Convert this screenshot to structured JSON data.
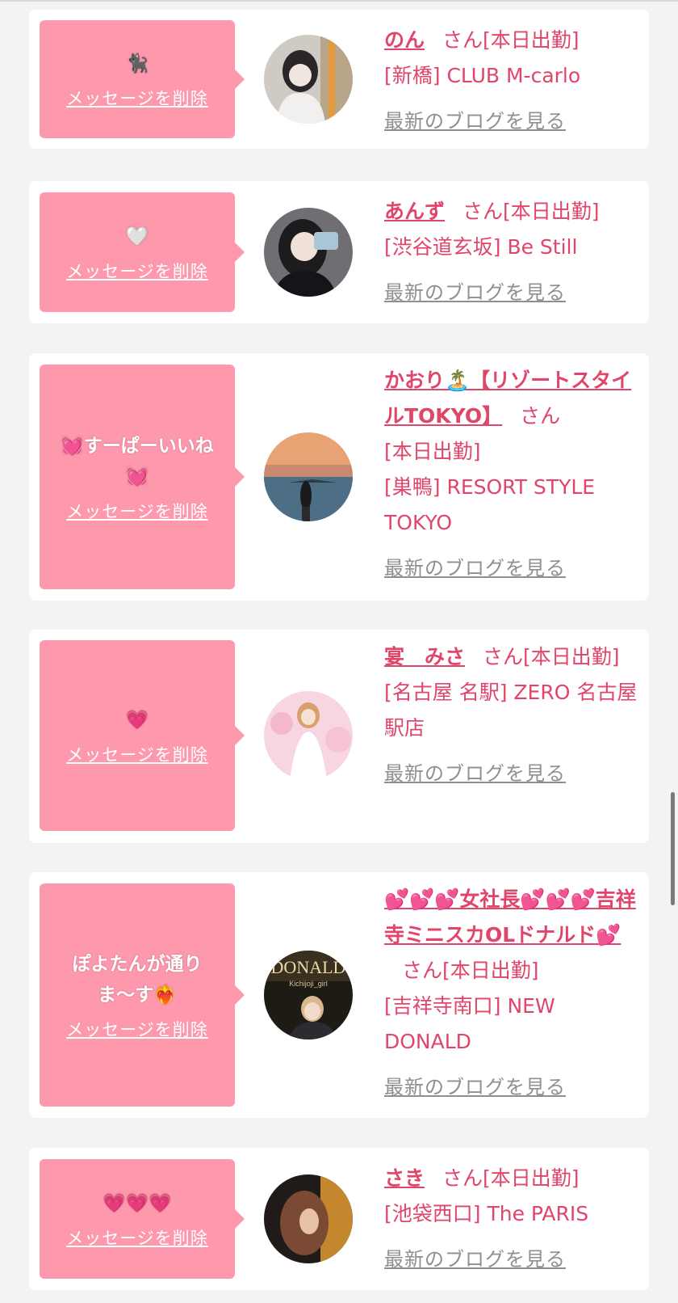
{
  "common": {
    "delete_label": "メッセージを削除",
    "san": "さん",
    "blog_label": "最新のブログを見る"
  },
  "cards": [
    {
      "message": "🐈‍⬛",
      "name": "のん",
      "status": "[本日出勤]",
      "shop": "[新橋] CLUB M-carlo"
    },
    {
      "message": "🤍",
      "name": "あんず",
      "status": "[本日出勤]",
      "shop": "[渋谷道玄坂] Be Still"
    },
    {
      "message": "💓すーぱーいいね💓",
      "name": "かおり🏝️【リゾートスタイルTOKYO】",
      "status": "[本日出勤]",
      "shop": "[巣鴨] RESORT STYLE TOKYO"
    },
    {
      "message": "💗",
      "name": "宴　みさ",
      "status": "[本日出勤]",
      "shop": "[名古屋 名駅] ZERO 名古屋駅店"
    },
    {
      "message": "ぽよたんが通りま〜す❤️‍🔥",
      "name": "💕💕💕女社長💕💕💕吉祥寺ミニスカOLドナルド💕",
      "status": "[本日出勤]",
      "shop": "[吉祥寺南口] NEW DONALD",
      "avatar_text": "DONALD",
      "avatar_subtext": "Kichijoji_girl"
    },
    {
      "message": "💗💗💗",
      "name": "さき",
      "status": "[本日出勤]",
      "shop": "[池袋西口] The PARIS"
    }
  ]
}
